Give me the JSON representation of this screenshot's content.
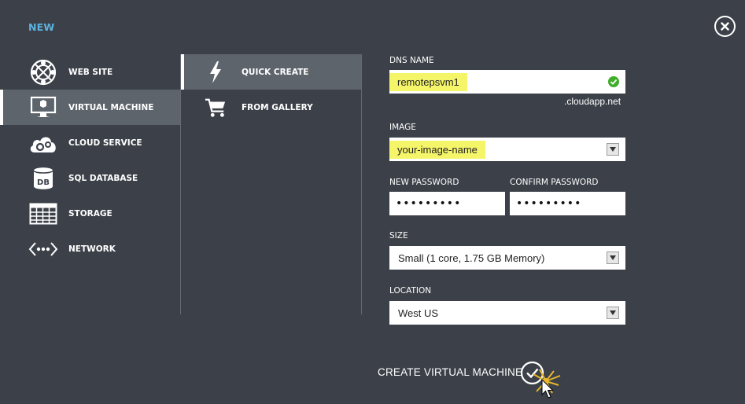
{
  "header": {
    "title": "NEW"
  },
  "categories": [
    {
      "label": "WEB SITE",
      "icon": "globe-icon"
    },
    {
      "label": "VIRTUAL MACHINE",
      "icon": "monitor-icon",
      "selected": true
    },
    {
      "label": "CLOUD SERVICE",
      "icon": "cloud-gear-icon"
    },
    {
      "label": "SQL DATABASE",
      "icon": "database-icon"
    },
    {
      "label": "STORAGE",
      "icon": "grid-table-icon"
    },
    {
      "label": "NETWORK",
      "icon": "network-icon"
    }
  ],
  "create_options": [
    {
      "label": "QUICK CREATE",
      "icon": "lightning-icon",
      "selected": true
    },
    {
      "label": "FROM GALLERY",
      "icon": "cart-icon"
    }
  ],
  "form": {
    "dns_name": {
      "label": "DNS NAME",
      "value": "remotepsvm1",
      "suffix": ".cloudapp.net",
      "status": "valid"
    },
    "image": {
      "label": "IMAGE",
      "value": "your-image-name"
    },
    "new_password": {
      "label": "NEW PASSWORD",
      "value": "•••••••••"
    },
    "confirm_password": {
      "label": "CONFIRM PASSWORD",
      "value": "•••••••••"
    },
    "size": {
      "label": "SIZE",
      "value": "Small (1 core, 1.75 GB Memory)"
    },
    "location": {
      "label": "LOCATION",
      "value": "West US"
    }
  },
  "actions": {
    "create_label": "CREATE VIRTUAL MACHINE"
  },
  "colors": {
    "background": "#3c4149",
    "accent": "#5eb2e0",
    "selected": "#5e646c",
    "highlight": "#f5f56a",
    "valid": "#3fae29"
  }
}
